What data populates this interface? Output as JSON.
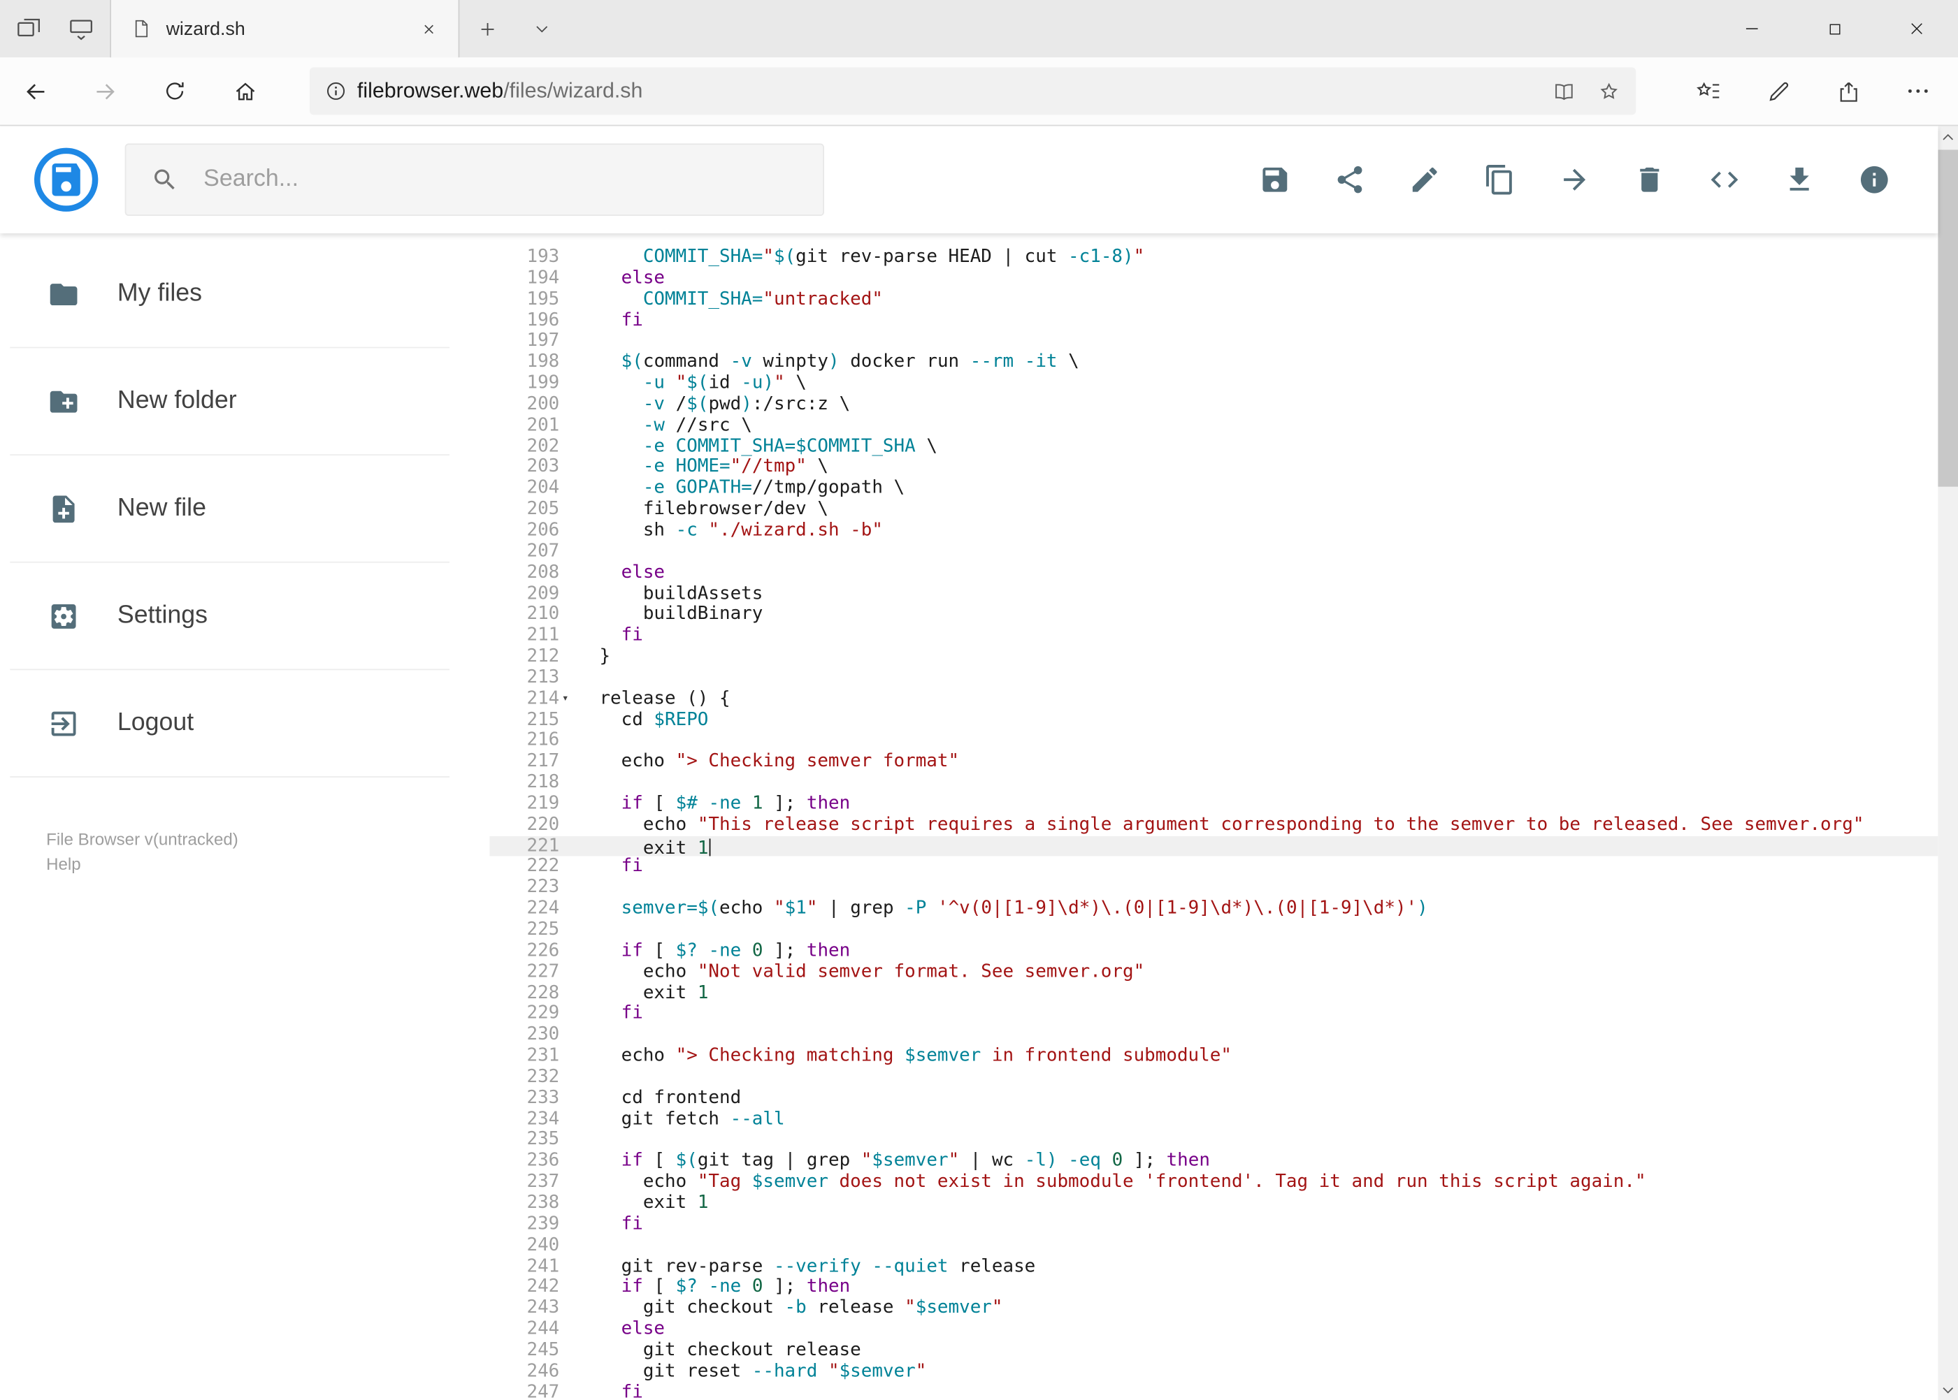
{
  "browser": {
    "tab_title": "wizard.sh",
    "url_host": "filebrowser.web",
    "url_path": "/files/wizard.sh"
  },
  "header": {
    "search_placeholder": "Search...",
    "toolbar": [
      "save",
      "share",
      "rename",
      "copy",
      "move",
      "delete",
      "code",
      "download",
      "info"
    ]
  },
  "sidebar": {
    "items": [
      {
        "icon": "folder",
        "label": "My files"
      },
      {
        "icon": "folder-plus",
        "label": "New folder"
      },
      {
        "icon": "file-plus",
        "label": "New file"
      },
      {
        "icon": "settings",
        "label": "Settings"
      },
      {
        "icon": "logout",
        "label": "Logout"
      }
    ],
    "footer_version": "File Browser v(untracked)",
    "footer_help": "Help"
  },
  "colors": {
    "accent_blue": "#1e88e5",
    "icon_gray": "#546e7a",
    "syntax_keyword": "#770088",
    "syntax_variable": "#008297",
    "syntax_string": "#a31414",
    "syntax_number": "#116644"
  },
  "editor": {
    "first_line": 193,
    "last_line": 247,
    "active_line": 221,
    "fold_marker_line": 214,
    "fold_glyph": "▾",
    "lines": [
      {
        "n": 193,
        "t": [
          [
            "p",
            "    "
          ],
          [
            "v",
            "COMMIT_SHA="
          ],
          [
            "s",
            "\""
          ],
          [
            "v",
            "$("
          ],
          [
            "p",
            "git rev-parse HEAD | cut "
          ],
          [
            "v",
            "-c1-8"
          ],
          [
            "v",
            ")"
          ],
          [
            "s",
            "\""
          ]
        ]
      },
      {
        "n": 194,
        "t": [
          [
            "p",
            "  "
          ],
          [
            "k",
            "else"
          ]
        ]
      },
      {
        "n": 195,
        "t": [
          [
            "p",
            "    "
          ],
          [
            "v",
            "COMMIT_SHA="
          ],
          [
            "s",
            "\"untracked\""
          ]
        ]
      },
      {
        "n": 196,
        "t": [
          [
            "p",
            "  "
          ],
          [
            "k",
            "fi"
          ]
        ]
      },
      {
        "n": 197,
        "t": []
      },
      {
        "n": 198,
        "t": [
          [
            "p",
            "  "
          ],
          [
            "v",
            "$("
          ],
          [
            "p",
            "command "
          ],
          [
            "v",
            "-v"
          ],
          [
            "p",
            " winpty"
          ],
          [
            "v",
            ")"
          ],
          [
            "p",
            " docker run "
          ],
          [
            "v",
            "--rm"
          ],
          [
            "p",
            " "
          ],
          [
            "v",
            "-it"
          ],
          [
            "p",
            " \\"
          ]
        ]
      },
      {
        "n": 199,
        "t": [
          [
            "p",
            "    "
          ],
          [
            "v",
            "-u"
          ],
          [
            "p",
            " "
          ],
          [
            "s",
            "\""
          ],
          [
            "v",
            "$("
          ],
          [
            "p",
            "id "
          ],
          [
            "v",
            "-u"
          ],
          [
            "v",
            ")"
          ],
          [
            "s",
            "\""
          ],
          [
            "p",
            " \\"
          ]
        ]
      },
      {
        "n": 200,
        "t": [
          [
            "p",
            "    "
          ],
          [
            "v",
            "-v"
          ],
          [
            "p",
            " /"
          ],
          [
            "v",
            "$("
          ],
          [
            "p",
            "pwd"
          ],
          [
            "v",
            ")"
          ],
          [
            "p",
            ":/src:z \\"
          ]
        ]
      },
      {
        "n": 201,
        "t": [
          [
            "p",
            "    "
          ],
          [
            "v",
            "-w"
          ],
          [
            "p",
            " //src \\"
          ]
        ]
      },
      {
        "n": 202,
        "t": [
          [
            "p",
            "    "
          ],
          [
            "v",
            "-e"
          ],
          [
            "p",
            " "
          ],
          [
            "v",
            "COMMIT_SHA=$COMMIT_SHA"
          ],
          [
            "p",
            " \\"
          ]
        ]
      },
      {
        "n": 203,
        "t": [
          [
            "p",
            "    "
          ],
          [
            "v",
            "-e"
          ],
          [
            "p",
            " "
          ],
          [
            "v",
            "HOME="
          ],
          [
            "s",
            "\"//tmp\""
          ],
          [
            "p",
            " \\"
          ]
        ]
      },
      {
        "n": 204,
        "t": [
          [
            "p",
            "    "
          ],
          [
            "v",
            "-e"
          ],
          [
            "p",
            " "
          ],
          [
            "v",
            "GOPATH="
          ],
          [
            "p",
            "//tmp/gopath \\"
          ]
        ]
      },
      {
        "n": 205,
        "t": [
          [
            "p",
            "    filebrowser/dev \\"
          ]
        ]
      },
      {
        "n": 206,
        "t": [
          [
            "p",
            "    sh "
          ],
          [
            "v",
            "-c"
          ],
          [
            "p",
            " "
          ],
          [
            "s",
            "\"./wizard.sh -b\""
          ]
        ]
      },
      {
        "n": 207,
        "t": []
      },
      {
        "n": 208,
        "t": [
          [
            "p",
            "  "
          ],
          [
            "k",
            "else"
          ]
        ]
      },
      {
        "n": 209,
        "t": [
          [
            "p",
            "    buildAssets"
          ]
        ]
      },
      {
        "n": 210,
        "t": [
          [
            "p",
            "    buildBinary"
          ]
        ]
      },
      {
        "n": 211,
        "t": [
          [
            "p",
            "  "
          ],
          [
            "k",
            "fi"
          ]
        ]
      },
      {
        "n": 212,
        "t": [
          [
            "p",
            "}"
          ]
        ]
      },
      {
        "n": 213,
        "t": []
      },
      {
        "n": 214,
        "fold": true,
        "t": [
          [
            "p",
            "release () {"
          ]
        ]
      },
      {
        "n": 215,
        "t": [
          [
            "p",
            "  cd "
          ],
          [
            "v",
            "$REPO"
          ]
        ]
      },
      {
        "n": 216,
        "t": []
      },
      {
        "n": 217,
        "t": [
          [
            "p",
            "  echo "
          ],
          [
            "s",
            "\"> Checking semver format\""
          ]
        ]
      },
      {
        "n": 218,
        "t": []
      },
      {
        "n": 219,
        "t": [
          [
            "p",
            "  "
          ],
          [
            "k",
            "if"
          ],
          [
            "p",
            " [ "
          ],
          [
            "v",
            "$#"
          ],
          [
            "p",
            " "
          ],
          [
            "v",
            "-ne"
          ],
          [
            "p",
            " "
          ],
          [
            "n",
            "1"
          ],
          [
            "p",
            " ]; "
          ],
          [
            "k",
            "then"
          ]
        ]
      },
      {
        "n": 220,
        "t": [
          [
            "p",
            "    echo "
          ],
          [
            "s",
            "\"This release script requires a single argument corresponding to the semver to be released. See semver.org\""
          ]
        ]
      },
      {
        "n": 221,
        "active": true,
        "cursor": true,
        "t": [
          [
            "p",
            "    exit "
          ],
          [
            "n",
            "1"
          ]
        ]
      },
      {
        "n": 222,
        "t": [
          [
            "p",
            "  "
          ],
          [
            "k",
            "fi"
          ]
        ]
      },
      {
        "n": 223,
        "t": []
      },
      {
        "n": 224,
        "t": [
          [
            "p",
            "  "
          ],
          [
            "v",
            "semver="
          ],
          [
            "v",
            "$("
          ],
          [
            "p",
            "echo "
          ],
          [
            "s",
            "\""
          ],
          [
            "v",
            "$1"
          ],
          [
            "s",
            "\""
          ],
          [
            "p",
            " | grep "
          ],
          [
            "v",
            "-P"
          ],
          [
            "p",
            " "
          ],
          [
            "s",
            "'^v(0|[1-9]\\d*)\\.(0|[1-9]\\d*)\\.(0|[1-9]\\d*)'"
          ],
          [
            "v",
            ")"
          ]
        ]
      },
      {
        "n": 225,
        "t": []
      },
      {
        "n": 226,
        "t": [
          [
            "p",
            "  "
          ],
          [
            "k",
            "if"
          ],
          [
            "p",
            " [ "
          ],
          [
            "v",
            "$?"
          ],
          [
            "p",
            " "
          ],
          [
            "v",
            "-ne"
          ],
          [
            "p",
            " "
          ],
          [
            "n",
            "0"
          ],
          [
            "p",
            " ]; "
          ],
          [
            "k",
            "then"
          ]
        ]
      },
      {
        "n": 227,
        "t": [
          [
            "p",
            "    echo "
          ],
          [
            "s",
            "\"Not valid semver format. See semver.org\""
          ]
        ]
      },
      {
        "n": 228,
        "t": [
          [
            "p",
            "    exit "
          ],
          [
            "n",
            "1"
          ]
        ]
      },
      {
        "n": 229,
        "t": [
          [
            "p",
            "  "
          ],
          [
            "k",
            "fi"
          ]
        ]
      },
      {
        "n": 230,
        "t": []
      },
      {
        "n": 231,
        "t": [
          [
            "p",
            "  echo "
          ],
          [
            "s",
            "\"> Checking matching "
          ],
          [
            "v",
            "$semver"
          ],
          [
            "s",
            " in frontend submodule\""
          ]
        ]
      },
      {
        "n": 232,
        "t": []
      },
      {
        "n": 233,
        "t": [
          [
            "p",
            "  cd frontend"
          ]
        ]
      },
      {
        "n": 234,
        "t": [
          [
            "p",
            "  git fetch "
          ],
          [
            "v",
            "--all"
          ]
        ]
      },
      {
        "n": 235,
        "t": []
      },
      {
        "n": 236,
        "t": [
          [
            "p",
            "  "
          ],
          [
            "k",
            "if"
          ],
          [
            "p",
            " [ "
          ],
          [
            "v",
            "$("
          ],
          [
            "p",
            "git tag | grep "
          ],
          [
            "s",
            "\""
          ],
          [
            "v",
            "$semver"
          ],
          [
            "s",
            "\""
          ],
          [
            "p",
            " | wc "
          ],
          [
            "v",
            "-l"
          ],
          [
            "v",
            ")"
          ],
          [
            "p",
            " "
          ],
          [
            "v",
            "-eq"
          ],
          [
            "p",
            " "
          ],
          [
            "n",
            "0"
          ],
          [
            "p",
            " ]; "
          ],
          [
            "k",
            "then"
          ]
        ]
      },
      {
        "n": 237,
        "t": [
          [
            "p",
            "    echo "
          ],
          [
            "s",
            "\"Tag "
          ],
          [
            "v",
            "$semver"
          ],
          [
            "s",
            " does not exist in submodule 'frontend'. Tag it and run this script again.\""
          ]
        ]
      },
      {
        "n": 238,
        "t": [
          [
            "p",
            "    exit "
          ],
          [
            "n",
            "1"
          ]
        ]
      },
      {
        "n": 239,
        "t": [
          [
            "p",
            "  "
          ],
          [
            "k",
            "fi"
          ]
        ]
      },
      {
        "n": 240,
        "t": []
      },
      {
        "n": 241,
        "t": [
          [
            "p",
            "  git rev-parse "
          ],
          [
            "v",
            "--verify"
          ],
          [
            "p",
            " "
          ],
          [
            "v",
            "--quiet"
          ],
          [
            "p",
            " release"
          ]
        ]
      },
      {
        "n": 242,
        "t": [
          [
            "p",
            "  "
          ],
          [
            "k",
            "if"
          ],
          [
            "p",
            " [ "
          ],
          [
            "v",
            "$?"
          ],
          [
            "p",
            " "
          ],
          [
            "v",
            "-ne"
          ],
          [
            "p",
            " "
          ],
          [
            "n",
            "0"
          ],
          [
            "p",
            " ]; "
          ],
          [
            "k",
            "then"
          ]
        ]
      },
      {
        "n": 243,
        "t": [
          [
            "p",
            "    git checkout "
          ],
          [
            "v",
            "-b"
          ],
          [
            "p",
            " release "
          ],
          [
            "s",
            "\""
          ],
          [
            "v",
            "$semver"
          ],
          [
            "s",
            "\""
          ]
        ]
      },
      {
        "n": 244,
        "t": [
          [
            "p",
            "  "
          ],
          [
            "k",
            "else"
          ]
        ]
      },
      {
        "n": 245,
        "t": [
          [
            "p",
            "    git checkout release"
          ]
        ]
      },
      {
        "n": 246,
        "t": [
          [
            "p",
            "    git reset "
          ],
          [
            "v",
            "--hard"
          ],
          [
            "p",
            " "
          ],
          [
            "s",
            "\""
          ],
          [
            "v",
            "$semver"
          ],
          [
            "s",
            "\""
          ]
        ]
      },
      {
        "n": 247,
        "t": [
          [
            "p",
            "  "
          ],
          [
            "k",
            "fi"
          ]
        ]
      }
    ]
  }
}
